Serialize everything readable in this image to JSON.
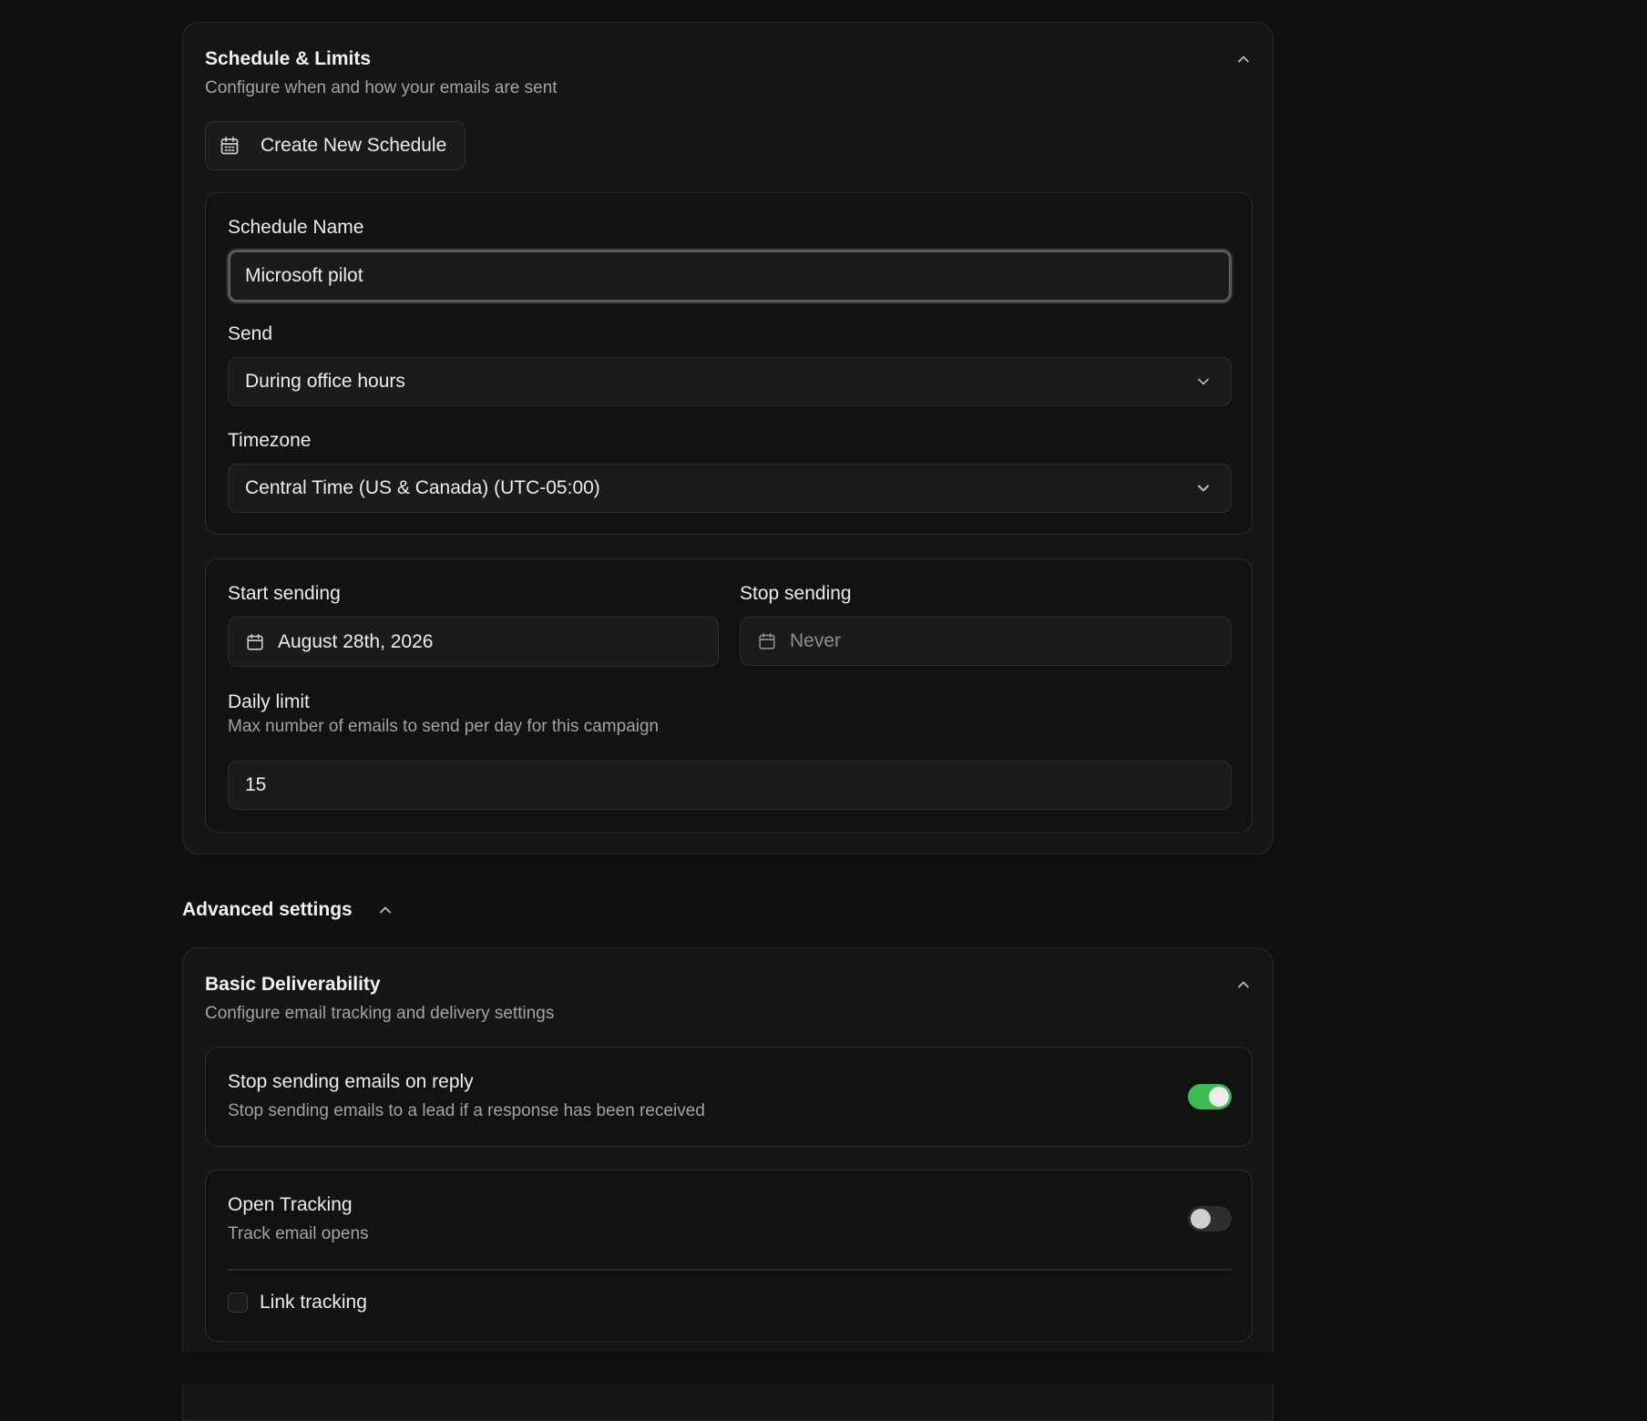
{
  "schedule_card": {
    "title": "Schedule & Limits",
    "subtitle": "Configure when and how your emails are sent",
    "create_button": "Create New Schedule",
    "schedule_name_label": "Schedule Name",
    "schedule_name_value": "Microsoft pilot",
    "send_label": "Send",
    "send_value": "During office hours",
    "timezone_label": "Timezone",
    "timezone_value": "Central Time (US & Canada) (UTC-05:00)",
    "start_label": "Start sending",
    "start_value": "August 28th, 2026",
    "stop_label": "Stop sending",
    "stop_value": "Never",
    "daily_limit_label": "Daily limit",
    "daily_limit_desc": "Max number of emails to send per day for this campaign",
    "daily_limit_value": "15"
  },
  "advanced": {
    "label": "Advanced settings"
  },
  "deliverability_card": {
    "title": "Basic Deliverability",
    "subtitle": "Configure email tracking and delivery settings",
    "stop_on_reply_title": "Stop sending emails on reply",
    "stop_on_reply_desc": "Stop sending emails to a lead if a response has been received",
    "stop_on_reply_enabled": true,
    "open_tracking_title": "Open Tracking",
    "open_tracking_desc": "Track email opens",
    "open_tracking_enabled": false,
    "link_tracking_label": "Link tracking",
    "link_tracking_checked": false
  },
  "colors": {
    "background": "#101010",
    "card": "#161616",
    "toggle_on": "#3fba53",
    "toggle_off": "#2e2e2e"
  }
}
